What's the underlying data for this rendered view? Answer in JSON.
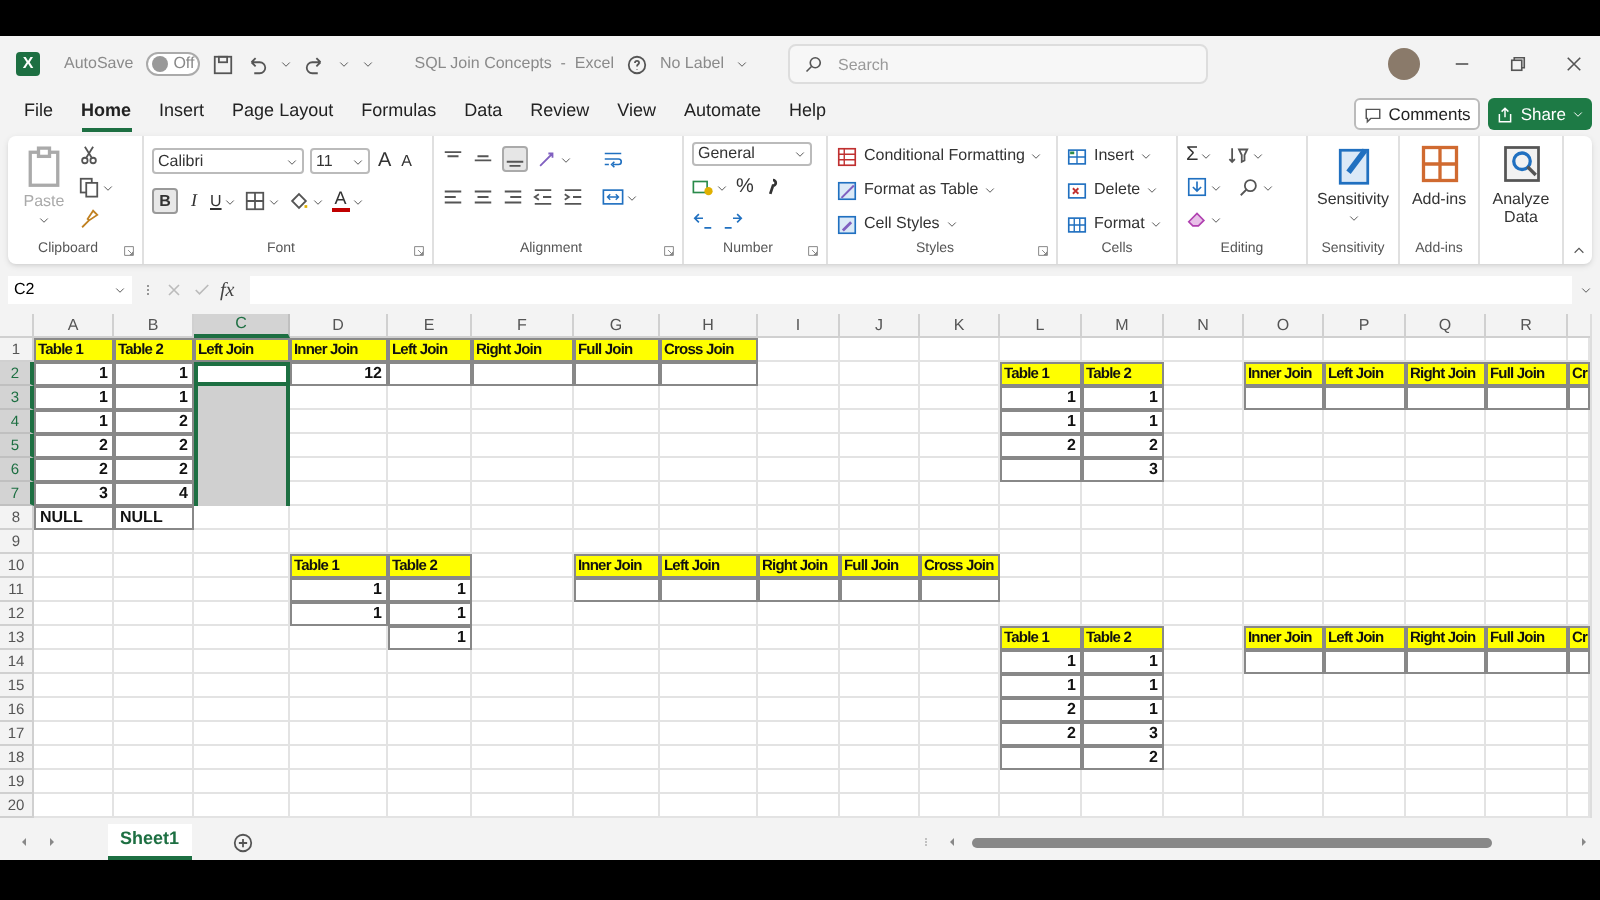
{
  "title_bar": {
    "logo": "X",
    "autosave_label": "AutoSave",
    "autosave_toggle": {
      "label": "Off",
      "on": false
    },
    "title": "SQL Join Concepts  -  Excel",
    "sensitivity_label": "No Label",
    "search": {
      "placeholder": "Search"
    }
  },
  "menu_tabs": [
    {
      "label": "File",
      "selected": false
    },
    {
      "label": "Home",
      "selected": true
    },
    {
      "label": "Insert",
      "selected": false
    },
    {
      "label": "Page Layout",
      "selected": false
    },
    {
      "label": "Formulas",
      "selected": false
    },
    {
      "label": "Data",
      "selected": false
    },
    {
      "label": "Review",
      "selected": false
    },
    {
      "label": "View",
      "selected": false
    },
    {
      "label": "Automate",
      "selected": false
    },
    {
      "label": "Help",
      "selected": false
    }
  ],
  "actions": [
    {
      "kind": "outline",
      "label": "Comments"
    },
    {
      "kind": "primary",
      "label": "Share"
    }
  ],
  "ribbon": [
    {
      "kind": "clipboard",
      "label": "Clipboard",
      "paste": {
        "label": "Paste",
        "disabled": true
      }
    },
    {
      "kind": "font",
      "label": "Font",
      "font_name": "Calibri",
      "font_size": "11",
      "grow_font": "A",
      "shrink_font": "A",
      "bold": {
        "label": "B",
        "on": true
      },
      "italic": "I",
      "underline": "U",
      "font_color": "A"
    },
    {
      "kind": "alignment",
      "label": "Alignment"
    },
    {
      "kind": "number",
      "label": "Number",
      "format": "General",
      "percent": "%"
    },
    {
      "kind": "styles",
      "label": "Styles",
      "buttons": [
        "Conditional Formatting",
        "Format as Table",
        "Cell Styles"
      ]
    },
    {
      "kind": "cells",
      "label": "Cells",
      "buttons": [
        "Insert",
        "Delete",
        "Format"
      ]
    },
    {
      "kind": "editing",
      "label": "Editing",
      "sum": "Σ"
    },
    {
      "kind": "sensitivity",
      "label": "Sensitivity",
      "button": "Sensitivity"
    },
    {
      "kind": "addins",
      "label": "Add-ins",
      "button": "Add-ins"
    },
    {
      "kind": "analyze",
      "button": "Analyze Data"
    }
  ],
  "formula_bar": {
    "name_box": "C2",
    "function_label": "fx"
  },
  "columns": [
    "A",
    "B",
    "C",
    "D",
    "E",
    "F",
    "G",
    "H",
    "I",
    "J",
    "K",
    "L",
    "M",
    "N",
    "O",
    "P",
    "Q",
    "R"
  ],
  "rows": [
    "1",
    "2",
    "3",
    "4",
    "5",
    "6",
    "7",
    "8",
    "9",
    "10",
    "11",
    "12",
    "13",
    "14",
    "15",
    "16",
    "17",
    "18",
    "19",
    "20"
  ],
  "blocks": [
    {
      "rows": [
        [
          {
            "kind": "header",
            "text": "Table 1",
            "selected": false
          },
          {
            "kind": "header",
            "text": "Table 2",
            "selected": false
          },
          {
            "kind": "header",
            "text": "Left Join",
            "selected": false
          }
        ],
        [
          {
            "kind": "number",
            "text": "1",
            "selected": false
          },
          {
            "kind": "number",
            "text": "1",
            "selected": false
          },
          {
            "kind": "blank",
            "selected": true,
            "active": true
          }
        ],
        [
          {
            "kind": "number",
            "text": "1",
            "selected": false
          },
          {
            "kind": "number",
            "text": "1",
            "selected": false
          },
          {
            "kind": "blank",
            "selected": true,
            "active": false
          }
        ],
        [
          {
            "kind": "number",
            "text": "1",
            "selected": false
          },
          {
            "kind": "number",
            "text": "2",
            "selected": false
          },
          {
            "kind": "blank",
            "selected": true,
            "active": false
          }
        ],
        [
          {
            "kind": "number",
            "text": "2",
            "selected": false
          },
          {
            "kind": "number",
            "text": "2",
            "selected": false
          },
          {
            "kind": "blank",
            "selected": true,
            "active": false
          }
        ],
        [
          {
            "kind": "number",
            "text": "2",
            "selected": false
          },
          {
            "kind": "number",
            "text": "2",
            "selected": false
          },
          {
            "kind": "blank",
            "selected": true,
            "active": false
          }
        ],
        [
          {
            "kind": "number",
            "text": "3",
            "selected": false
          },
          {
            "kind": "number",
            "text": "4",
            "selected": false
          },
          {
            "kind": "blank",
            "selected": true,
            "active": false
          }
        ],
        [
          {
            "kind": "text",
            "text": "NULL",
            "selected": false
          },
          {
            "kind": "text",
            "text": "NULL",
            "selected": false
          }
        ]
      ]
    },
    {
      "rows": [
        [
          {
            "kind": "header",
            "text": "Inner Join",
            "selected": false
          },
          {
            "kind": "header",
            "text": "Left Join",
            "selected": false
          },
          {
            "kind": "header",
            "text": "Right Join",
            "selected": false
          },
          {
            "kind": "header",
            "text": "Full Join",
            "selected": false
          },
          {
            "kind": "header",
            "text": "Cross Join",
            "selected": false
          }
        ],
        [
          {
            "kind": "number",
            "text": "12",
            "selected": false
          },
          {
            "kind": "blank",
            "selected": false
          },
          {
            "kind": "blank",
            "selected": false
          },
          {
            "kind": "blank",
            "selected": false
          },
          {
            "kind": "blank",
            "selected": false
          }
        ]
      ]
    },
    {
      "rows": [
        [
          {
            "kind": "header",
            "text": "Table 1",
            "selected": false
          },
          {
            "kind": "header",
            "text": "Table 2",
            "selected": false
          }
        ],
        [
          {
            "kind": "number",
            "text": "1",
            "selected": false
          },
          {
            "kind": "number",
            "text": "1",
            "selected": false
          }
        ],
        [
          {
            "kind": "number",
            "text": "1",
            "selected": false
          },
          {
            "kind": "number",
            "text": "1",
            "selected": false
          }
        ]
      ]
    },
    {
      "rows": [
        [
          {
            "kind": "number",
            "text": "1",
            "selected": false
          }
        ]
      ]
    },
    {
      "rows": [
        [
          {
            "kind": "header",
            "text": "Inner Join",
            "selected": false
          },
          {
            "kind": "header",
            "text": "Left Join",
            "selected": false
          },
          {
            "kind": "header",
            "text": "Right Join",
            "selected": false
          },
          {
            "kind": "header",
            "text": "Full Join",
            "selected": false
          },
          {
            "kind": "header",
            "text": "Cross Join",
            "selected": false
          }
        ],
        [
          {
            "kind": "blank",
            "selected": false
          },
          {
            "kind": "blank",
            "selected": false
          },
          {
            "kind": "blank",
            "selected": false
          },
          {
            "kind": "blank",
            "selected": false
          },
          {
            "kind": "blank",
            "selected": false
          }
        ]
      ]
    },
    {
      "rows": [
        [
          {
            "kind": "header",
            "text": "Table 1",
            "selected": false
          },
          {
            "kind": "header",
            "text": "Table 2",
            "selected": false
          }
        ],
        [
          {
            "kind": "number",
            "text": "1",
            "selected": false
          },
          {
            "kind": "number",
            "text": "1",
            "selected": false
          }
        ],
        [
          {
            "kind": "number",
            "text": "1",
            "selected": false
          },
          {
            "kind": "number",
            "text": "1",
            "selected": false
          }
        ],
        [
          {
            "kind": "number",
            "text": "2",
            "selected": false
          },
          {
            "kind": "number",
            "text": "2",
            "selected": false
          }
        ],
        [
          {
            "kind": "blank",
            "selected": false
          },
          {
            "kind": "number",
            "text": "3",
            "selected": false
          }
        ]
      ]
    },
    {
      "rows": [
        [
          {
            "kind": "header",
            "text": "Inner Join",
            "selected": false
          },
          {
            "kind": "header",
            "text": "Left Join",
            "selected": false
          },
          {
            "kind": "header",
            "text": "Right Join",
            "selected": false
          },
          {
            "kind": "header",
            "text": "Full Join",
            "selected": false
          },
          {
            "kind": "header",
            "text": "Cr",
            "selected": false
          }
        ],
        [
          {
            "kind": "blank",
            "selected": false
          },
          {
            "kind": "blank",
            "selected": false
          },
          {
            "kind": "blank",
            "selected": false
          },
          {
            "kind": "blank",
            "selected": false
          },
          {
            "kind": "blank",
            "selected": false
          }
        ]
      ]
    },
    {
      "rows": [
        [
          {
            "kind": "header",
            "text": "Table 1",
            "selected": false
          },
          {
            "kind": "header",
            "text": "Table 2",
            "selected": false
          }
        ],
        [
          {
            "kind": "number",
            "text": "1",
            "selected": false
          },
          {
            "kind": "number",
            "text": "1",
            "selected": false
          }
        ],
        [
          {
            "kind": "number",
            "text": "1",
            "selected": false
          },
          {
            "kind": "number",
            "text": "1",
            "selected": false
          }
        ],
        [
          {
            "kind": "number",
            "text": "2",
            "selected": false
          },
          {
            "kind": "number",
            "text": "1",
            "selected": false
          }
        ],
        [
          {
            "kind": "number",
            "text": "2",
            "selected": false
          },
          {
            "kind": "number",
            "text": "3",
            "selected": false
          }
        ],
        [
          {
            "kind": "blank",
            "selected": false
          },
          {
            "kind": "number",
            "text": "2",
            "selected": false
          }
        ]
      ]
    },
    {
      "rows": [
        [
          {
            "kind": "header",
            "text": "Inner Join",
            "selected": false
          },
          {
            "kind": "header",
            "text": "Left Join",
            "selected": false
          },
          {
            "kind": "header",
            "text": "Right Join",
            "selected": false
          },
          {
            "kind": "header",
            "text": "Full Join",
            "selected": false
          },
          {
            "kind": "header",
            "text": "Cr",
            "selected": false
          }
        ],
        [
          {
            "kind": "blank",
            "selected": false
          },
          {
            "kind": "blank",
            "selected": false
          },
          {
            "kind": "blank",
            "selected": false
          },
          {
            "kind": "blank",
            "selected": false
          },
          {
            "kind": "blank",
            "selected": false
          }
        ]
      ]
    }
  ],
  "sheet_tabs": [
    {
      "label": "Sheet1",
      "selected": true
    }
  ]
}
